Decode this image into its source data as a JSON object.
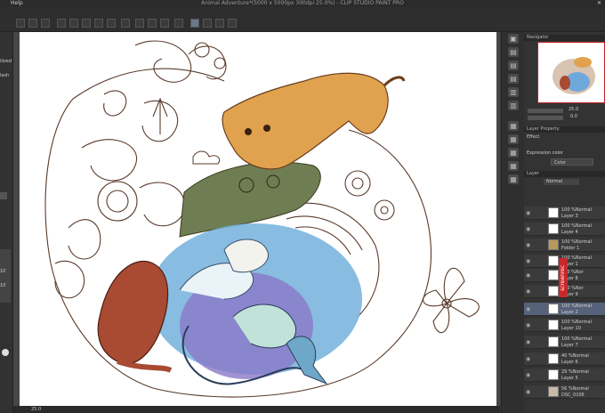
{
  "titlebar": {
    "menu_help": "Help",
    "title": "Animal Adventure*(5000 x 5000px 300dpi 25.0%) - CLIP STUDIO PAINT PRO",
    "close": "✕"
  },
  "left_panel": {
    "labels": [
      "ilized",
      "lash"
    ],
    "numbers": [
      "10",
      "10"
    ]
  },
  "navigator": {
    "tab": "Navigator",
    "zoom": "25.0",
    "angle": "0.0"
  },
  "layer_property": {
    "tab": "Layer Property",
    "effect_label": "Effect",
    "expression_label": "Expression color",
    "expression_value": "Color"
  },
  "layer_panel": {
    "tab": "Layer",
    "blend_mode": "Normal",
    "layers": [
      {
        "pct": "100 %Normal",
        "name": "Layer 3",
        "selected": false
      },
      {
        "pct": "100 %Normal",
        "name": "Layer 4",
        "selected": false
      },
      {
        "pct": "100 %Normal",
        "name": "Folder 1",
        "selected": false
      },
      {
        "pct": "100 %Normal",
        "name": "Layer 1",
        "selected": false
      },
      {
        "pct": "100 %Nor",
        "name": "Layer 8",
        "selected": false
      },
      {
        "pct": "100 %Nor",
        "name": "Layer 9",
        "selected": false
      },
      {
        "pct": "100 %Normal",
        "name": "Layer 2",
        "selected": true
      },
      {
        "pct": "100 %Normal",
        "name": "Layer 10",
        "selected": false
      },
      {
        "pct": "100 %Normal",
        "name": "Layer 7",
        "selected": false
      },
      {
        "pct": "40 %Normal",
        "name": "Layer 6",
        "selected": false
      },
      {
        "pct": "29 %Normal",
        "name": "Layer 5",
        "selected": false
      },
      {
        "pct": "56 %Normal",
        "name": "DSC_0106",
        "selected": false
      }
    ]
  },
  "watermark": "screenrec",
  "status": {
    "zoom": "25.0"
  }
}
